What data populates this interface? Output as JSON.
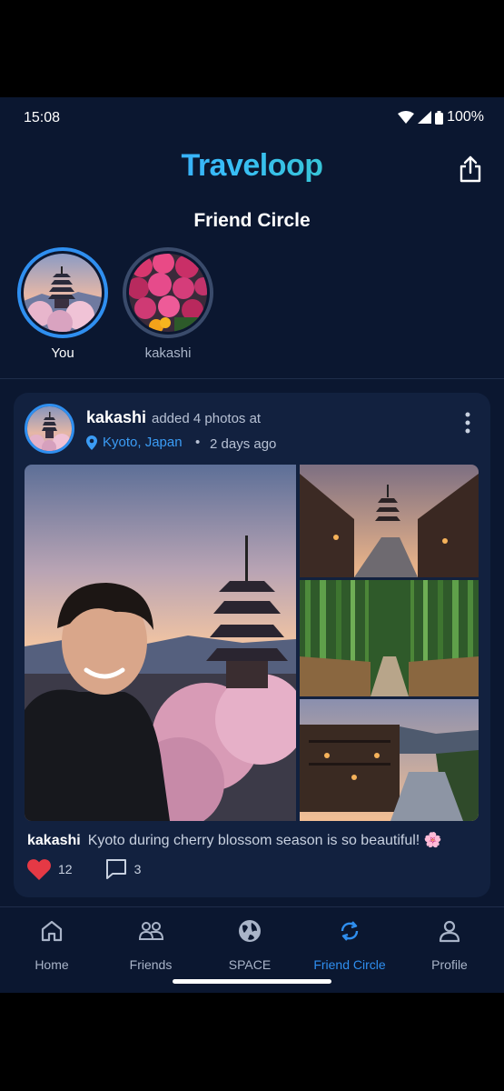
{
  "status_bar": {
    "time": "15:08",
    "battery": "100%"
  },
  "header": {
    "logo": "Traveloop",
    "title": "Friend Circle"
  },
  "stories": [
    {
      "label": "You",
      "active": true
    },
    {
      "label": "kakashi",
      "active": false
    }
  ],
  "post": {
    "username": "kakashi",
    "action": "added 4 photos at",
    "location": "Kyoto, Japan",
    "separator": "•",
    "time_ago": "2 days ago",
    "caption_user": "kakashi",
    "caption": "Kyoto during cherry blossom season is so beautiful! 🌸",
    "likes": "12",
    "comments": "3"
  },
  "nav": {
    "items": [
      {
        "label": "Home",
        "icon": "home-icon"
      },
      {
        "label": "Friends",
        "icon": "friends-icon"
      },
      {
        "label": "SPACE",
        "icon": "globe-icon"
      },
      {
        "label": "Friend Circle",
        "icon": "sync-icon"
      },
      {
        "label": "Profile",
        "icon": "profile-icon"
      }
    ],
    "active": "Friend Circle"
  },
  "colors": {
    "accent": "#2f8ff0",
    "background": "#0b1730",
    "card": "#12213f",
    "like": "#e53945"
  }
}
